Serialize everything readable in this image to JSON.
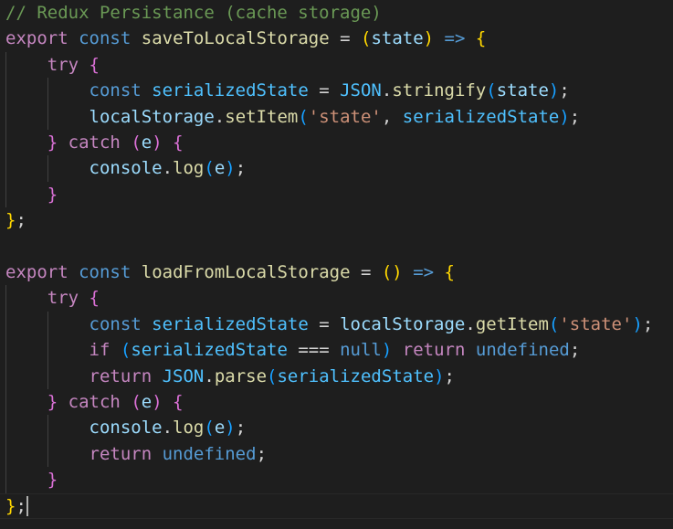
{
  "editor": {
    "colors": {
      "background": "#1e1e1e",
      "comment": "#6a9955",
      "keyword_control": "#c586c0",
      "keyword_storage": "#569cd6",
      "function": "#dcdcaa",
      "variable": "#9cdcfe",
      "constant": "#4fc1ff",
      "string": "#ce9178",
      "type_class": "#4ec9b0",
      "punctuation": "#d4d4d4",
      "bracket_gold": "#ffd700",
      "bracket_pink": "#da70d6",
      "bracket_blue": "#179fff"
    },
    "lines": [
      {
        "indent": 0,
        "tokens": [
          {
            "t": "// Redux Persistance (cache storage)",
            "c": "comment"
          }
        ]
      },
      {
        "indent": 0,
        "tokens": [
          {
            "t": "export",
            "c": "keyword_control"
          },
          {
            "t": " ",
            "c": "punctuation"
          },
          {
            "t": "const",
            "c": "keyword_storage"
          },
          {
            "t": " ",
            "c": "punctuation"
          },
          {
            "t": "saveToLocalStorage",
            "c": "function"
          },
          {
            "t": " = ",
            "c": "punctuation"
          },
          {
            "t": "(",
            "c": "bracket_gold"
          },
          {
            "t": "state",
            "c": "variable"
          },
          {
            "t": ")",
            "c": "bracket_gold"
          },
          {
            "t": " ",
            "c": "punctuation"
          },
          {
            "t": "=>",
            "c": "keyword_storage"
          },
          {
            "t": " ",
            "c": "punctuation"
          },
          {
            "t": "{",
            "c": "bracket_gold"
          }
        ]
      },
      {
        "indent": 1,
        "tokens": [
          {
            "t": "try",
            "c": "keyword_control"
          },
          {
            "t": " ",
            "c": "punctuation"
          },
          {
            "t": "{",
            "c": "bracket_pink"
          }
        ]
      },
      {
        "indent": 2,
        "tokens": [
          {
            "t": "const",
            "c": "keyword_storage"
          },
          {
            "t": " ",
            "c": "punctuation"
          },
          {
            "t": "serializedState",
            "c": "constant"
          },
          {
            "t": " = ",
            "c": "punctuation"
          },
          {
            "t": "JSON",
            "c": "constant"
          },
          {
            "t": ".",
            "c": "punctuation"
          },
          {
            "t": "stringify",
            "c": "function"
          },
          {
            "t": "(",
            "c": "bracket_blue"
          },
          {
            "t": "state",
            "c": "variable"
          },
          {
            "t": ")",
            "c": "bracket_blue"
          },
          {
            "t": ";",
            "c": "punctuation"
          }
        ]
      },
      {
        "indent": 2,
        "tokens": [
          {
            "t": "localStorage",
            "c": "variable"
          },
          {
            "t": ".",
            "c": "punctuation"
          },
          {
            "t": "setItem",
            "c": "function"
          },
          {
            "t": "(",
            "c": "bracket_blue"
          },
          {
            "t": "'state'",
            "c": "string"
          },
          {
            "t": ", ",
            "c": "punctuation"
          },
          {
            "t": "serializedState",
            "c": "constant"
          },
          {
            "t": ")",
            "c": "bracket_blue"
          },
          {
            "t": ";",
            "c": "punctuation"
          }
        ]
      },
      {
        "indent": 1,
        "tokens": [
          {
            "t": "}",
            "c": "bracket_pink"
          },
          {
            "t": " ",
            "c": "punctuation"
          },
          {
            "t": "catch",
            "c": "keyword_control"
          },
          {
            "t": " ",
            "c": "punctuation"
          },
          {
            "t": "(",
            "c": "bracket_pink"
          },
          {
            "t": "e",
            "c": "variable"
          },
          {
            "t": ")",
            "c": "bracket_pink"
          },
          {
            "t": " ",
            "c": "punctuation"
          },
          {
            "t": "{",
            "c": "bracket_pink"
          }
        ]
      },
      {
        "indent": 2,
        "tokens": [
          {
            "t": "console",
            "c": "variable"
          },
          {
            "t": ".",
            "c": "punctuation"
          },
          {
            "t": "log",
            "c": "function"
          },
          {
            "t": "(",
            "c": "bracket_blue"
          },
          {
            "t": "e",
            "c": "variable"
          },
          {
            "t": ")",
            "c": "bracket_blue"
          },
          {
            "t": ";",
            "c": "punctuation"
          }
        ]
      },
      {
        "indent": 1,
        "tokens": [
          {
            "t": "}",
            "c": "bracket_pink"
          }
        ]
      },
      {
        "indent": 0,
        "tokens": [
          {
            "t": "}",
            "c": "bracket_gold"
          },
          {
            "t": ";",
            "c": "punctuation"
          }
        ]
      },
      {
        "indent": 0,
        "tokens": []
      },
      {
        "indent": 0,
        "tokens": [
          {
            "t": "export",
            "c": "keyword_control"
          },
          {
            "t": " ",
            "c": "punctuation"
          },
          {
            "t": "const",
            "c": "keyword_storage"
          },
          {
            "t": " ",
            "c": "punctuation"
          },
          {
            "t": "loadFromLocalStorage",
            "c": "function"
          },
          {
            "t": " = ",
            "c": "punctuation"
          },
          {
            "t": "()",
            "c": "bracket_gold"
          },
          {
            "t": " ",
            "c": "punctuation"
          },
          {
            "t": "=>",
            "c": "keyword_storage"
          },
          {
            "t": " ",
            "c": "punctuation"
          },
          {
            "t": "{",
            "c": "bracket_gold"
          }
        ]
      },
      {
        "indent": 1,
        "tokens": [
          {
            "t": "try",
            "c": "keyword_control"
          },
          {
            "t": " ",
            "c": "punctuation"
          },
          {
            "t": "{",
            "c": "bracket_pink"
          }
        ]
      },
      {
        "indent": 2,
        "tokens": [
          {
            "t": "const",
            "c": "keyword_storage"
          },
          {
            "t": " ",
            "c": "punctuation"
          },
          {
            "t": "serializedState",
            "c": "constant"
          },
          {
            "t": " = ",
            "c": "punctuation"
          },
          {
            "t": "localStorage",
            "c": "variable"
          },
          {
            "t": ".",
            "c": "punctuation"
          },
          {
            "t": "getItem",
            "c": "function"
          },
          {
            "t": "(",
            "c": "bracket_blue"
          },
          {
            "t": "'state'",
            "c": "string"
          },
          {
            "t": ")",
            "c": "bracket_blue"
          },
          {
            "t": ";",
            "c": "punctuation"
          }
        ]
      },
      {
        "indent": 2,
        "tokens": [
          {
            "t": "if",
            "c": "keyword_control"
          },
          {
            "t": " ",
            "c": "punctuation"
          },
          {
            "t": "(",
            "c": "bracket_blue"
          },
          {
            "t": "serializedState",
            "c": "constant"
          },
          {
            "t": " === ",
            "c": "punctuation"
          },
          {
            "t": "null",
            "c": "keyword_storage"
          },
          {
            "t": ")",
            "c": "bracket_blue"
          },
          {
            "t": " ",
            "c": "punctuation"
          },
          {
            "t": "return",
            "c": "keyword_control"
          },
          {
            "t": " ",
            "c": "punctuation"
          },
          {
            "t": "undefined",
            "c": "keyword_storage"
          },
          {
            "t": ";",
            "c": "punctuation"
          }
        ]
      },
      {
        "indent": 2,
        "tokens": [
          {
            "t": "return",
            "c": "keyword_control"
          },
          {
            "t": " ",
            "c": "punctuation"
          },
          {
            "t": "JSON",
            "c": "constant"
          },
          {
            "t": ".",
            "c": "punctuation"
          },
          {
            "t": "parse",
            "c": "function"
          },
          {
            "t": "(",
            "c": "bracket_blue"
          },
          {
            "t": "serializedState",
            "c": "constant"
          },
          {
            "t": ")",
            "c": "bracket_blue"
          },
          {
            "t": ";",
            "c": "punctuation"
          }
        ]
      },
      {
        "indent": 1,
        "tokens": [
          {
            "t": "}",
            "c": "bracket_pink"
          },
          {
            "t": " ",
            "c": "punctuation"
          },
          {
            "t": "catch",
            "c": "keyword_control"
          },
          {
            "t": " ",
            "c": "punctuation"
          },
          {
            "t": "(",
            "c": "bracket_pink"
          },
          {
            "t": "e",
            "c": "variable"
          },
          {
            "t": ")",
            "c": "bracket_pink"
          },
          {
            "t": " ",
            "c": "punctuation"
          },
          {
            "t": "{",
            "c": "bracket_pink"
          }
        ]
      },
      {
        "indent": 2,
        "tokens": [
          {
            "t": "console",
            "c": "variable"
          },
          {
            "t": ".",
            "c": "punctuation"
          },
          {
            "t": "log",
            "c": "function"
          },
          {
            "t": "(",
            "c": "bracket_blue"
          },
          {
            "t": "e",
            "c": "variable"
          },
          {
            "t": ")",
            "c": "bracket_blue"
          },
          {
            "t": ";",
            "c": "punctuation"
          }
        ]
      },
      {
        "indent": 2,
        "tokens": [
          {
            "t": "return",
            "c": "keyword_control"
          },
          {
            "t": " ",
            "c": "punctuation"
          },
          {
            "t": "undefined",
            "c": "keyword_storage"
          },
          {
            "t": ";",
            "c": "punctuation"
          }
        ]
      },
      {
        "indent": 1,
        "tokens": [
          {
            "t": "}",
            "c": "bracket_pink"
          }
        ]
      },
      {
        "indent": 0,
        "tokens": [
          {
            "t": "}",
            "c": "bracket_gold"
          },
          {
            "t": ";",
            "c": "punctuation"
          }
        ]
      }
    ]
  }
}
